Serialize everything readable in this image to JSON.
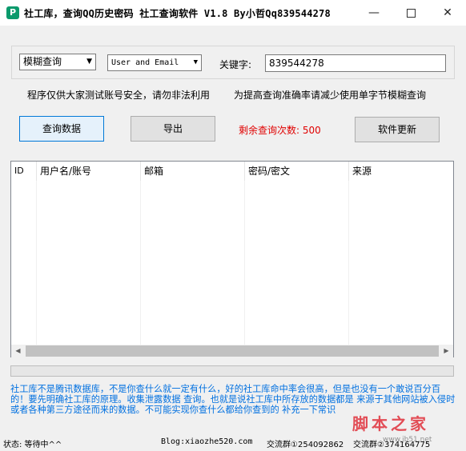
{
  "window": {
    "title": "社工库，查询QQ历史密码 社工查询软件 V1.8   By小哲Qq839544278",
    "icon_glyph": "P",
    "min_glyph": "—",
    "close_glyph": "✕"
  },
  "search": {
    "mode_value": "模糊查询",
    "field_value": "User and Email",
    "keyword_label": "关键字:",
    "keyword_value": "839544278"
  },
  "notices": {
    "left": "程序仅供大家测试账号安全，请勿非法利用",
    "right": "为提高查询准确率请减少使用单字节模糊查询"
  },
  "buttons": {
    "query": "查询数据",
    "export": "导出",
    "update": "软件更新"
  },
  "remaining": "剩余查询次数: 500",
  "table": {
    "columns": [
      "ID",
      "用户名/账号",
      "邮箱",
      "密码/密文",
      "来源"
    ],
    "rows": []
  },
  "info_text": "社工库不是腾讯数据库，不是你查什么就一定有什么，好的社工库命中率会很高，但是也没有一个敢说百分百的！要先明确社工库的原理。收集泄露数据 查询。也就是说社工库中所存放的数据都是 来源于其他网站被入侵时或者各种第三方途径而来的数据。不可能实现你查什么都给你查到的 补充一下常识",
  "statusbar": {
    "status": "状态: 等待中^^",
    "blog": "Blog:xiaozhe520.com",
    "group1": "交流群①254092862",
    "group2": "交流群②374164775"
  },
  "watermark": {
    "text": "脚本之家",
    "url": "www.jb51.net"
  }
}
